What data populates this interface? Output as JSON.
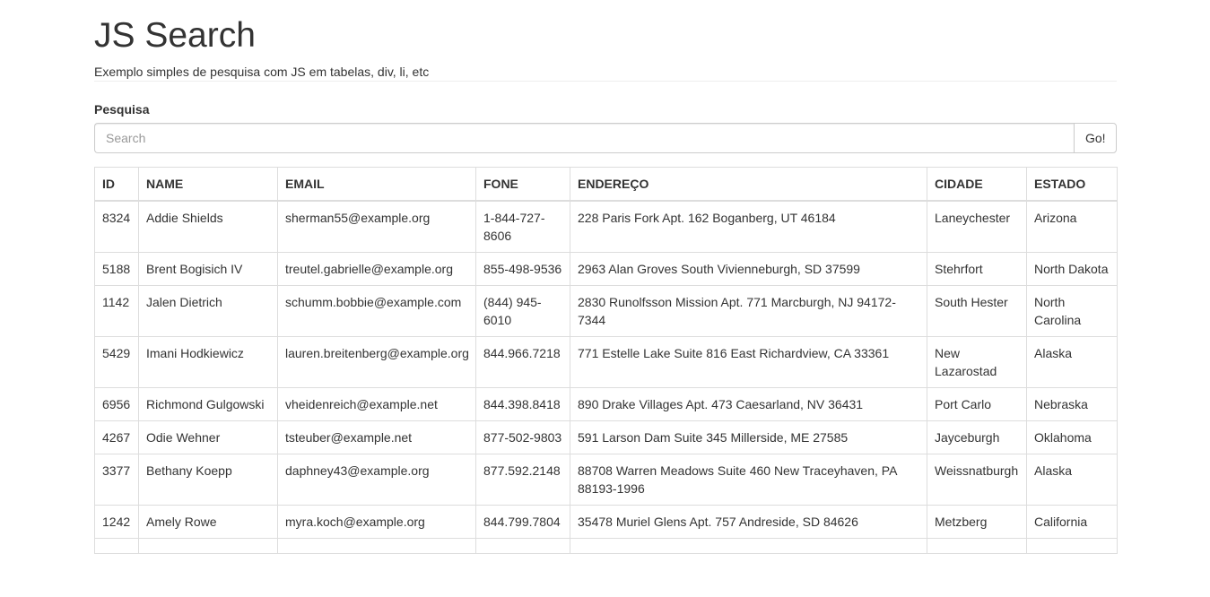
{
  "header": {
    "title": "JS Search",
    "subtitle": "Exemplo simples de pesquisa com JS em tabelas, div, li, etc"
  },
  "search": {
    "label": "Pesquisa",
    "placeholder": "Search",
    "value": "",
    "button_label": "Go!"
  },
  "table": {
    "columns": [
      "ID",
      "NAME",
      "EMAIL",
      "FONE",
      "ENDEREÇO",
      "CIDADE",
      "ESTADO"
    ],
    "rows": [
      [
        "8324",
        "Addie Shields",
        "sherman55@example.org",
        "1-844-727-8606",
        "228 Paris Fork Apt. 162 Boganberg, UT 46184",
        "Laneychester",
        "Arizona"
      ],
      [
        "5188",
        "Brent Bogisich IV",
        "treutel.gabrielle@example.org",
        "855-498-9536",
        "2963 Alan Groves South Vivienneburgh, SD 37599",
        "Stehrfort",
        "North Dakota"
      ],
      [
        "1142",
        "Jalen Dietrich",
        "schumm.bobbie@example.com",
        "(844) 945-6010",
        "2830 Runolfsson Mission Apt. 771 Marcburgh, NJ 94172-7344",
        "South Hester",
        "North Carolina"
      ],
      [
        "5429",
        "Imani Hodkiewicz",
        "lauren.breitenberg@example.org",
        "844.966.7218",
        "771 Estelle Lake Suite 816 East Richardview, CA 33361",
        "New Lazarostad",
        "Alaska"
      ],
      [
        "6956",
        "Richmond Gulgowski",
        "vheidenreich@example.net",
        "844.398.8418",
        "890 Drake Villages Apt. 473 Caesarland, NV 36431",
        "Port Carlo",
        "Nebraska"
      ],
      [
        "4267",
        "Odie Wehner",
        "tsteuber@example.net",
        "877-502-9803",
        "591 Larson Dam Suite 345 Millerside, ME 27585",
        "Jayceburgh",
        "Oklahoma"
      ],
      [
        "3377",
        "Bethany Koepp",
        "daphney43@example.org",
        "877.592.2148",
        "88708 Warren Meadows Suite 460 New Traceyhaven, PA 88193-1996",
        "Weissnatburgh",
        "Alaska"
      ],
      [
        "1242",
        "Amely Rowe",
        "myra.koch@example.org",
        "844.799.7804",
        "35478 Muriel Glens Apt. 757 Andreside, SD 84626",
        "Metzberg",
        "California"
      ],
      [
        "",
        "",
        "",
        "",
        "",
        "",
        ""
      ]
    ]
  }
}
